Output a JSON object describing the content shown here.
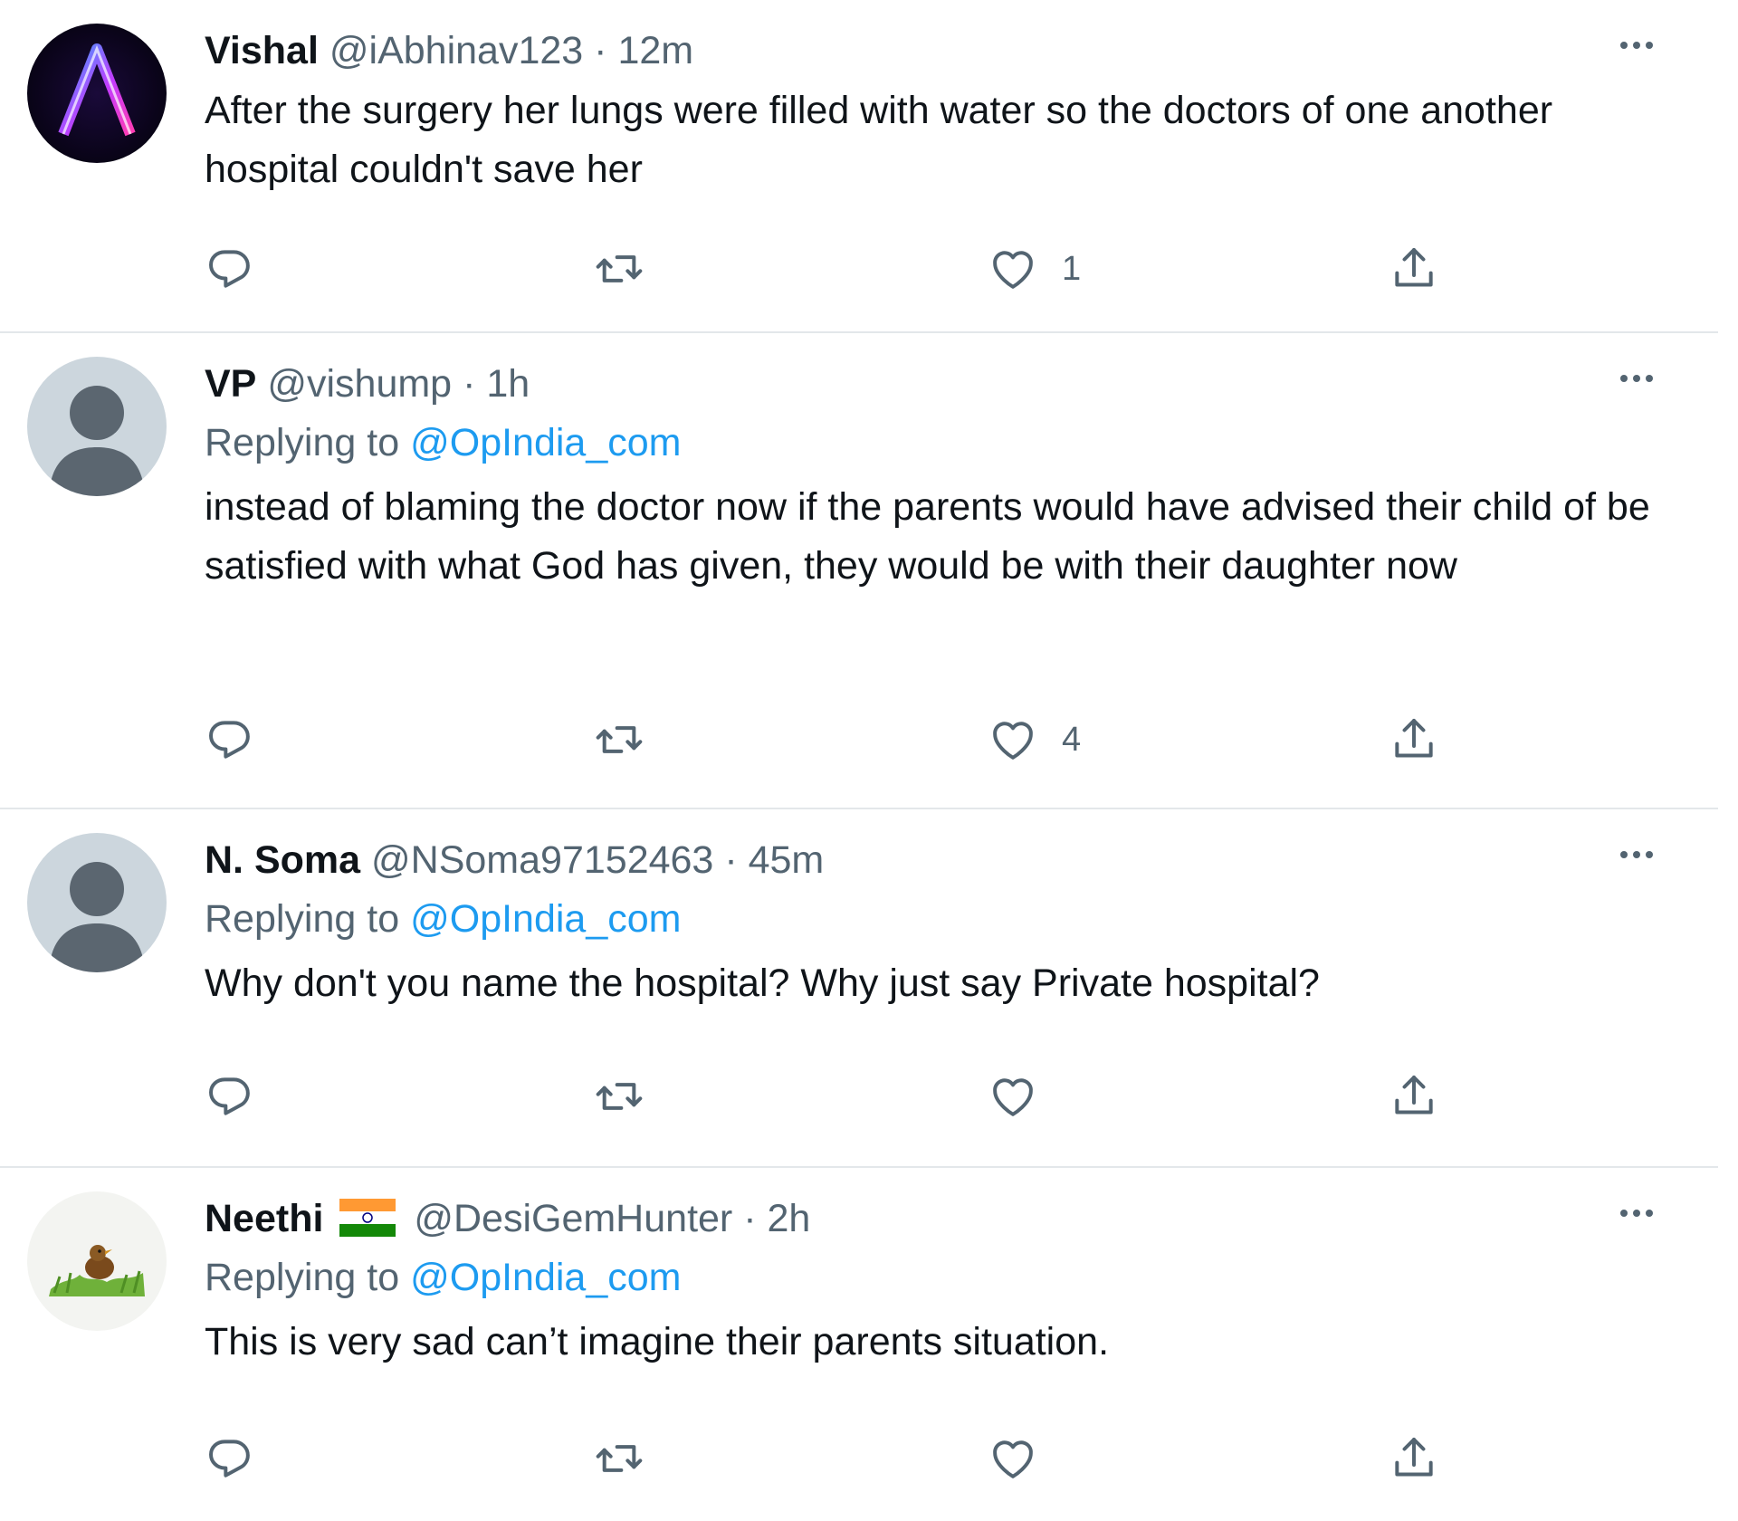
{
  "colors": {
    "link": "#1d9bf0",
    "secondary_text": "#536471",
    "primary_text": "#0f1419",
    "divider": "#e3e7ea"
  },
  "tweets": [
    {
      "name": "Vishal",
      "handle": "@iAbhinav123",
      "separator": "·",
      "time": "12m",
      "avatar": "letter-a-neon-avatar",
      "replying_prefix": "",
      "replying_to": "",
      "text": "After the surgery her lungs were filled with water so the doctors of one another hospital couldn't save her",
      "likes": "1"
    },
    {
      "name": "VP",
      "handle": "@vishump",
      "separator": "·",
      "time": "1h",
      "avatar": "default-user-avatar",
      "replying_prefix": "Replying to",
      "replying_to": "@OpIndia_com",
      "text": "instead of blaming the doctor now if the parents would have advised their child of be satisfied with what God has given, they would be with their daughter now",
      "likes": "4"
    },
    {
      "name": "N. Soma",
      "handle": "@NSoma97152463",
      "separator": "·",
      "time": "45m",
      "avatar": "default-user-avatar",
      "replying_prefix": "Replying to",
      "replying_to": "@OpIndia_com",
      "text": "Why don't you name the hospital? Why just say Private hospital?",
      "likes": ""
    },
    {
      "name": "Neethi",
      "handle": "@DesiGemHunter",
      "separator": "·",
      "time": "2h",
      "avatar": "bird-on-grass-avatar",
      "flag": "india-flag-icon",
      "replying_prefix": "Replying to",
      "replying_to": "@OpIndia_com",
      "text": "This is very sad can’t imagine their parents situation.",
      "likes": ""
    }
  ]
}
